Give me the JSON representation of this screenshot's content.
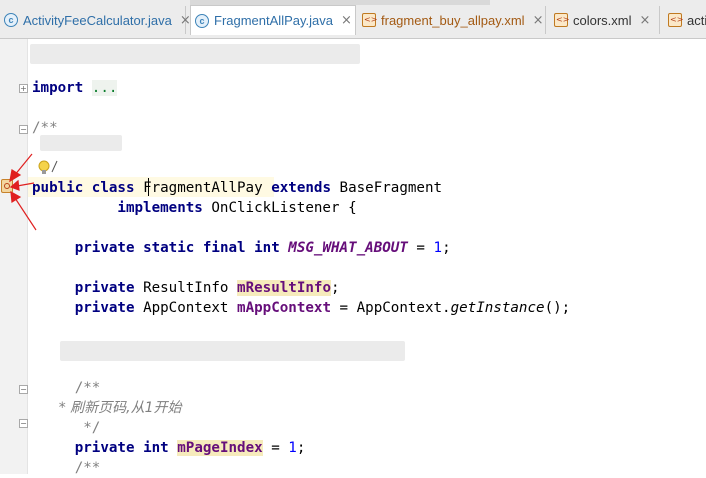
{
  "tabs": [
    {
      "label": "ActivityFeeCalculator.java",
      "icon": "class-icon",
      "kind": "java",
      "active": false
    },
    {
      "label": "FragmentAllPay.java",
      "icon": "class-icon",
      "kind": "java",
      "active": true
    },
    {
      "label": "fragment_buy_allpay.xml",
      "icon": "xml-file-icon",
      "kind": "xml",
      "active": false
    },
    {
      "label": "colors.xml",
      "icon": "xml-file-icon",
      "kind": "xml",
      "active": false
    },
    {
      "label": "acti",
      "icon": "xml-file-icon",
      "kind": "xml",
      "active": false
    }
  ],
  "tab_close_glyph": "×",
  "tab_icon_letter": "c",
  "colors": {
    "keyword": "#000080",
    "field": "#660e7a",
    "number": "#0000ff",
    "comment": "#808080",
    "arrow": "#e02020",
    "caret_line": "#fffae3"
  },
  "code": {
    "import_kw": "import",
    "import_fold": "...",
    "doc_open": "/**",
    "public_kw": "public",
    "class_kw": "class",
    "class_name": "FragmentAllPay",
    "extends_kw": "extends",
    "base_class": "BaseFragment",
    "implements_kw": "implements",
    "interface_name": "OnClickListener",
    "open_brace": "{",
    "private_kw": "private",
    "static_kw": "static",
    "final_kw": "final",
    "int_kw": "int",
    "const_name": "MSG_WHAT_ABOUT",
    "assign": " = ",
    "const_value": "1",
    "semicolon": ";",
    "result_type": "ResultInfo",
    "result_field": "mResultInfo",
    "context_type": "AppContext",
    "context_field": "mAppContext",
    "context_init_class": "AppContext.",
    "context_init_method": "getInstance",
    "call_parens": "()",
    "comment_open": "/**",
    "comment_body": " * 刷新页码,从1开始",
    "comment_close": " */",
    "page_field": "mPageIndex",
    "page_value": "1",
    "doc_open_2": "/**"
  },
  "icons": {
    "gutter_marker": "implemented-method-icon",
    "bulb": "intention-bulb-icon",
    "arrows": "red-arrow-icon"
  }
}
